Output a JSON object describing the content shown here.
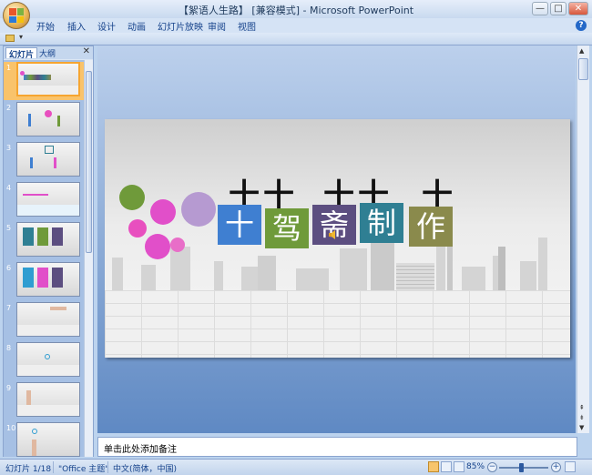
{
  "window": {
    "title": "【絮语人生路】 [兼容模式] - Microsoft PowerPoint",
    "minimize": "—",
    "maximize": "□",
    "close": "✕"
  },
  "ribbon": {
    "tabs": [
      "开始",
      "插入",
      "设计",
      "动画",
      "幻灯片放映",
      "审阅",
      "视图"
    ],
    "help": "?"
  },
  "quick_access": {
    "dropdown": "▾"
  },
  "pane": {
    "tabs": [
      "幻灯片",
      "大纲"
    ],
    "close": "✕",
    "thumbnails": [
      "1",
      "2",
      "3",
      "4",
      "5",
      "6",
      "7",
      "8",
      "9",
      "10"
    ],
    "selected": 1
  },
  "slide": {
    "characters": [
      "十",
      "驾",
      "斋",
      "制",
      "作"
    ],
    "char_colors": [
      "#3f7fd1",
      "#6f9a3a",
      "#5c4e80",
      "#2f7f93",
      "#8a8a4c"
    ],
    "crosses": [
      "十",
      "十",
      "十",
      "十",
      "十"
    ],
    "circle_colors": [
      "#6f9a3a",
      "#e14fc9",
      "#b69ad1",
      "#e84fbf",
      "#e14fc9",
      "#e86ec8"
    ]
  },
  "notes": {
    "placeholder": "单击此处添加备注"
  },
  "status_bar": {
    "slide_info": "幻灯片 1/18",
    "theme": "\"Office 主题\"",
    "language": "中文(简体，中国)",
    "zoom": "85%",
    "zoom_minus": "−",
    "zoom_plus": "+"
  },
  "colors": {
    "workspace": "#5f89c3",
    "selected_thumb": "#f6a530",
    "ribbon_text": "#15428b"
  }
}
